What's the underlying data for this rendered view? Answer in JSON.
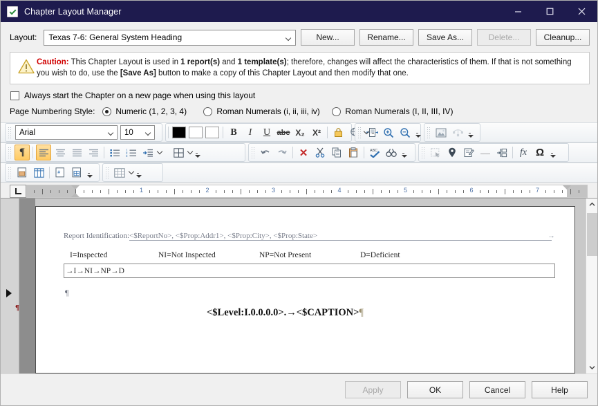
{
  "window": {
    "title": "Chapter Layout Manager",
    "icon": "checklist-icon",
    "minimize": "—",
    "maximize": "□",
    "close": "✕"
  },
  "layout_row": {
    "label": "Layout:",
    "selected": "Texas 7-6: General System Heading",
    "buttons": [
      {
        "label": "New...",
        "enabled": true
      },
      {
        "label": "Rename...",
        "enabled": true
      },
      {
        "label": "Save As...",
        "enabled": true
      },
      {
        "label": "Delete...",
        "enabled": false
      },
      {
        "label": "Cleanup...",
        "enabled": true
      }
    ]
  },
  "caution": {
    "word": "Caution:",
    "text_1": " This Chapter Layout is used in ",
    "bold_1": "1 report(s)",
    "text_2": " and ",
    "bold_2": "1 template(s)",
    "text_3": "; therefore, changes will affect the characteristics of them. If that is not something you wish to do, use the ",
    "bold_3": "[Save As]",
    "text_4": " button to make a copy of this Chapter Layout and then modify that one.",
    "color": "#d00000"
  },
  "checkbox": {
    "label": "Always start the Chapter on a new page when using this layout",
    "checked": false
  },
  "page_numbering": {
    "label": "Page Numbering Style:",
    "options": [
      {
        "label": "Numeric (1, 2, 3, 4)",
        "selected": true
      },
      {
        "label": "Roman Numerals (i, ii, iii, iv)",
        "selected": false
      },
      {
        "label": "Roman Numerals (I, II, III, IV)",
        "selected": false
      }
    ]
  },
  "toolbar_font": {
    "font_name": "Arial",
    "font_size": "10",
    "text_color": "#000000",
    "highlight_color": "#ffffff",
    "background_color": "#ffffff",
    "buttons": [
      {
        "name": "bold-button",
        "glyph": "B"
      },
      {
        "name": "italic-button",
        "glyph": "I"
      },
      {
        "name": "underline-button",
        "glyph": "U"
      },
      {
        "name": "strikethrough-button",
        "glyph": "abc"
      },
      {
        "name": "subscript-button",
        "glyph": "X₂"
      },
      {
        "name": "superscript-button",
        "glyph": "X²"
      },
      {
        "name": "lock-icon",
        "glyph": "🔒"
      },
      {
        "name": "hyperlink-icon",
        "glyph": "🌐"
      }
    ],
    "view_buttons": [
      {
        "name": "page-view-icon",
        "glyph": "❐"
      },
      {
        "name": "zoom-in-icon",
        "glyph": "⌕"
      },
      {
        "name": "zoom-out-icon",
        "glyph": "⌕"
      }
    ],
    "image_buttons": [
      {
        "name": "insert-image-icon",
        "glyph": "🖼"
      },
      {
        "name": "image-align-icon",
        "glyph": "⚇"
      }
    ]
  },
  "toolbar_paragraph": {
    "buttons": [
      {
        "name": "show-formatting-marks-button",
        "glyph": "¶",
        "active": true
      },
      {
        "name": "align-left-button",
        "glyph": "≡",
        "active": true
      },
      {
        "name": "align-center-button",
        "glyph": "≡",
        "active": false
      },
      {
        "name": "align-justify-button",
        "glyph": "≡",
        "active": false
      },
      {
        "name": "align-right-button",
        "glyph": "≡",
        "active": false
      },
      {
        "name": "bullet-list-button",
        "glyph": "☰"
      },
      {
        "name": "numbered-list-button",
        "glyph": "☰"
      },
      {
        "name": "indent-button",
        "glyph": "⇥"
      },
      {
        "name": "table-button",
        "glyph": "⊞"
      }
    ],
    "edit_buttons": [
      {
        "name": "undo-button",
        "glyph": "↶"
      },
      {
        "name": "redo-button",
        "glyph": "↷"
      },
      {
        "name": "delete-button",
        "glyph": "✕"
      },
      {
        "name": "cut-button",
        "glyph": "✂"
      },
      {
        "name": "copy-button",
        "glyph": "❐"
      },
      {
        "name": "paste-button",
        "glyph": "📋"
      },
      {
        "name": "spellcheck-button",
        "glyph": "ABC"
      },
      {
        "name": "find-button",
        "glyph": "🔍"
      }
    ],
    "insert_buttons": [
      {
        "name": "select-all-icon",
        "glyph": "⬚"
      },
      {
        "name": "location-pin-icon",
        "glyph": "📍"
      },
      {
        "name": "edit-note-icon",
        "glyph": "✎"
      },
      {
        "name": "horizontal-line-icon",
        "glyph": "—"
      },
      {
        "name": "page-break-icon",
        "glyph": "⊣"
      },
      {
        "name": "formula-icon",
        "glyph": "fx"
      },
      {
        "name": "symbol-icon",
        "glyph": "Ω"
      }
    ]
  },
  "toolbar_insert": {
    "buttons": [
      {
        "name": "insert-page-icon",
        "glyph": "▤"
      },
      {
        "name": "insert-grid-icon",
        "glyph": "⊞"
      },
      {
        "name": "insert-field-icon",
        "glyph": "#"
      },
      {
        "name": "insert-data-field-icon",
        "glyph": "⊞"
      }
    ],
    "table_buttons": [
      {
        "name": "table-properties-icon",
        "glyph": "⊞"
      }
    ]
  },
  "ruler": {
    "numbers": [
      "1",
      "2",
      "3",
      "4",
      "5",
      "6",
      "7"
    ],
    "unit": "inches"
  },
  "document": {
    "report_identification_label": "Report Identification:",
    "report_identification_fields": "<$ReportNo>, <$Prop:Addr1>, <$Prop:City>, <$Prop:State>",
    "legend": [
      "I=Inspected",
      "NI=Not Inspected",
      "NP=Not Present",
      "D=Deficient"
    ],
    "table_row": "→I→NI→NP→D",
    "paragraph_mark": "¶",
    "caption": "<$Level:I.0.0.0.0>.→<$CAPTION>",
    "caption_mark": "¶"
  },
  "footer": {
    "buttons": [
      {
        "label": "Apply",
        "enabled": false
      },
      {
        "label": "OK",
        "enabled": true
      },
      {
        "label": "Cancel",
        "enabled": true
      },
      {
        "label": "Help",
        "enabled": true
      }
    ]
  }
}
